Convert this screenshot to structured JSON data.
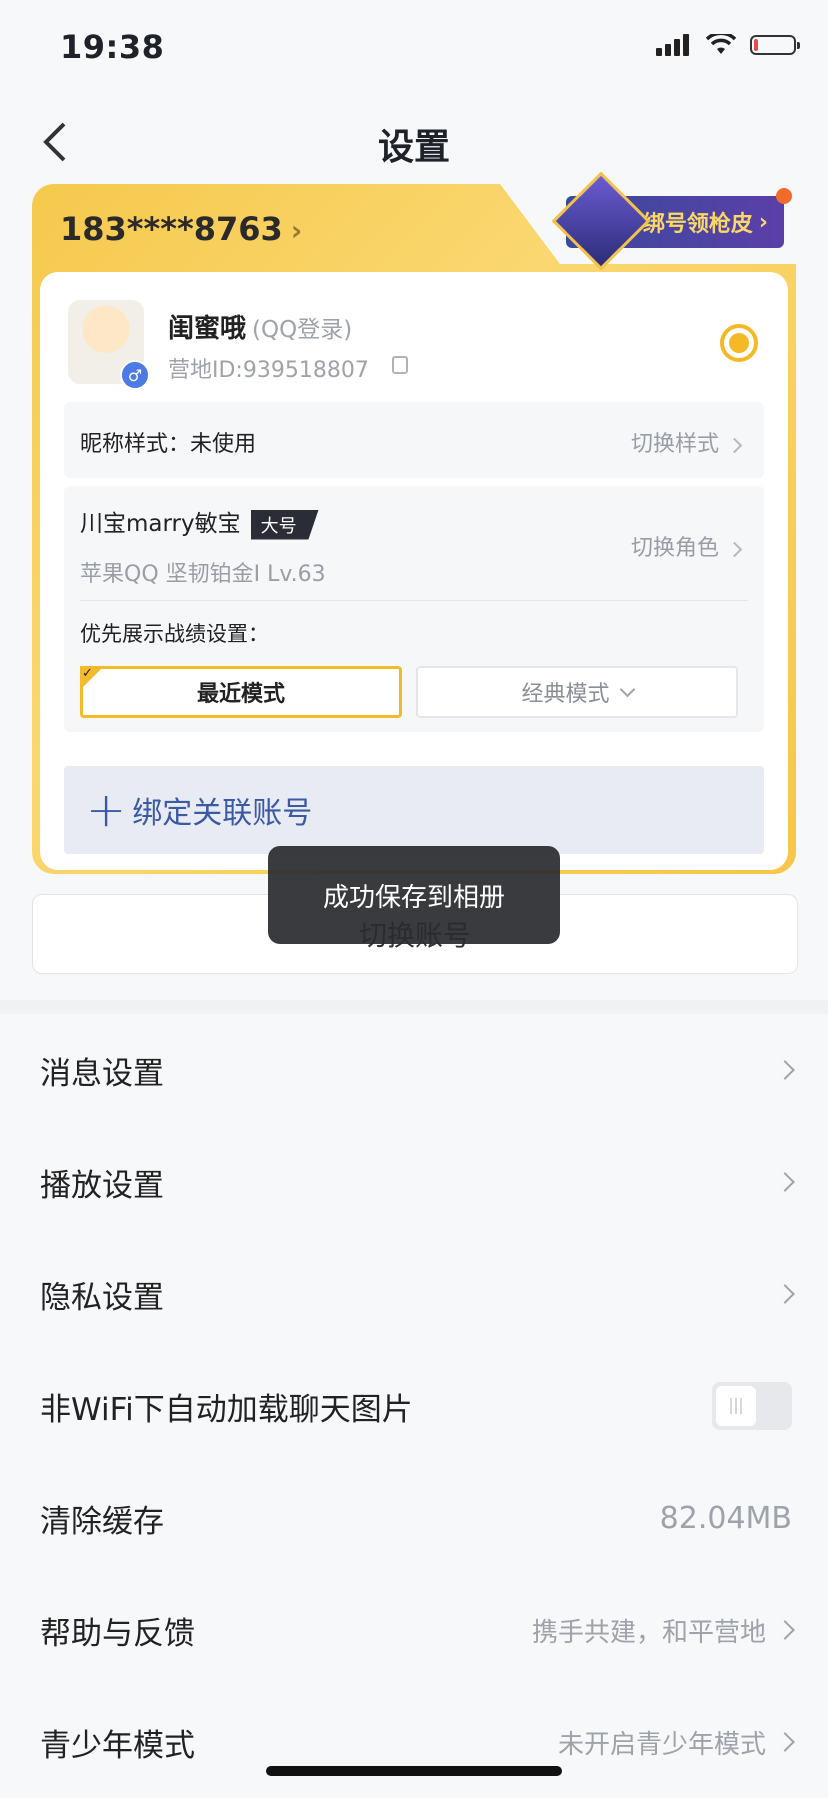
{
  "status_bar": {
    "time": "19:38"
  },
  "header": {
    "title": "设置"
  },
  "account_card": {
    "phone": "183****8763",
    "promo_badge": "绑号领枪皮",
    "nickname": "闺蜜哦",
    "login_type": "(QQ登录)",
    "camp_id": "营地ID:939518807",
    "nick_style_label": "昵称样式：未使用",
    "nick_style_action": "切换样式",
    "role_name": "川宝marry敏宝",
    "role_tag": "大号",
    "role_sub": "苹果QQ  坚韧铂金Ⅰ Lv.63",
    "role_action": "切换角色",
    "pref_label": "优先展示战绩设置：",
    "mode_recent": "最近模式",
    "mode_classic": "经典模式",
    "bind_label": "绑定关联账号"
  },
  "switch_account": "切换账号",
  "toast": "成功保存到相册",
  "settings": {
    "message": "消息设置",
    "playback": "播放设置",
    "privacy": "隐私设置",
    "wifi_images": "非WiFi下自动加载聊天图片",
    "clear_cache": "清除缓存",
    "cache_size": "82.04MB",
    "help": "帮助与反馈",
    "help_value": "携手共建，和平营地",
    "youth": "青少年模式",
    "youth_value": "未开启青少年模式"
  },
  "toggles": {
    "wifi_images_on": false
  }
}
